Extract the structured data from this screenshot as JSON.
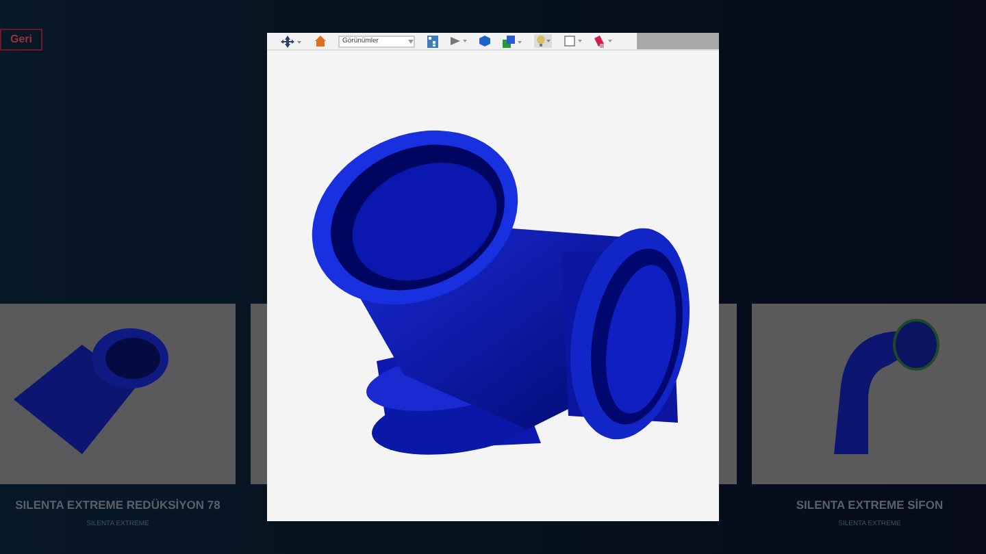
{
  "back_button": {
    "label": "Geri"
  },
  "products": [
    {
      "title": "SILENTA EXTREME REDÜKSİYON 78",
      "subtitle": "SILENTA EXTREME",
      "kind": "reducer"
    },
    {
      "kind": "hidden"
    },
    {
      "kind": "hidden"
    },
    {
      "title": "SILENTA EXTREME SİFON",
      "subtitle": "SILENTA EXTREME",
      "kind": "siphon"
    }
  ],
  "viewer": {
    "view_select": {
      "value": "Görünümler"
    }
  }
}
